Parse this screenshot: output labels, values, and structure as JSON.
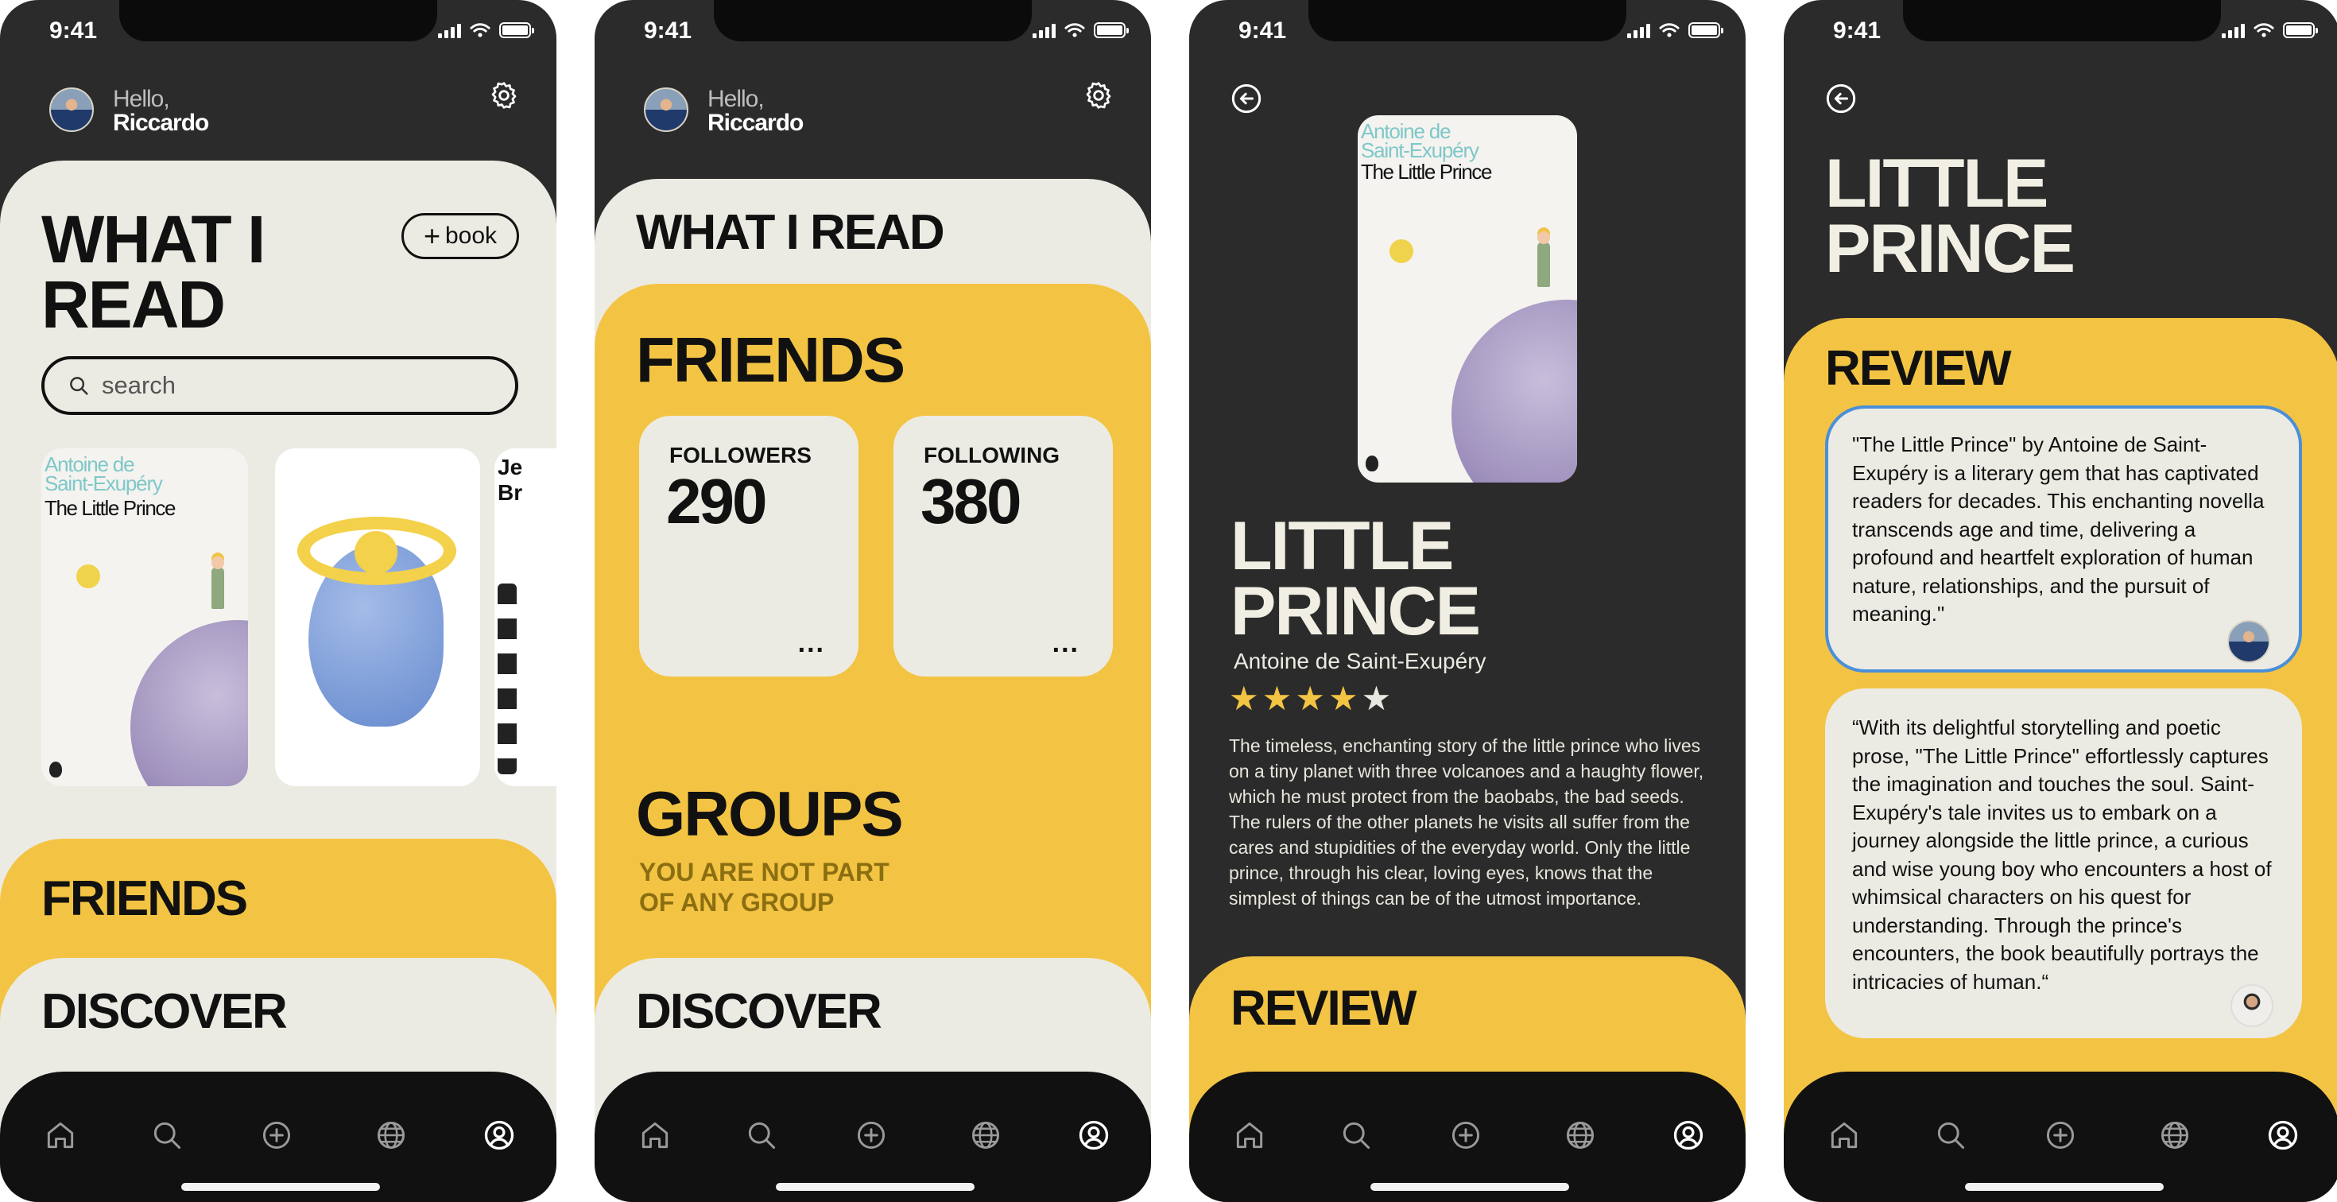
{
  "status": {
    "time": "9:41"
  },
  "greeting": {
    "hello": "Hello,",
    "name": "Riccardo"
  },
  "home": {
    "title_line1": "WHAT I",
    "title_line2": "READ",
    "add_book_label": "book",
    "search_placeholder": "search",
    "sections": {
      "friends": "FRIENDS",
      "discover": "DISCOVER"
    }
  },
  "friends_screen": {
    "what_i_read": "WHAT I READ",
    "friends_title": "FRIENDS",
    "followers_label": "FOLLOWERS",
    "followers_value": "290",
    "following_label": "FOLLOWING",
    "following_value": "380",
    "more": "...",
    "groups_title": "GROUPS",
    "groups_empty_line1": "YOU ARE NOT PART",
    "groups_empty_line2": "OF ANY GROUP",
    "discover": "DISCOVER"
  },
  "book": {
    "cover_author_line1": "Antoine de",
    "cover_author_line2": "Saint-Exupéry",
    "cover_title": "The Little Prince",
    "title_line1": "LITTLE",
    "title_line2": "PRINCE",
    "author": "Antoine de Saint-Exupéry",
    "rating": 4,
    "rating_max": 5,
    "description": "The timeless, enchanting story of the little prince who lives on a tiny planet with three volcanoes and a haughty flower, which he must protect from the baobabs, the bad seeds. The rulers of the other planets he visits all suffer from the cares and stupidities of the everyday world. Only the little prince, through his clear, loving eyes, knows that the simplest of things can be of the utmost importance.",
    "review_title": "REVIEW"
  },
  "third_cover_snippet": {
    "line1": "Je",
    "line2": "Br"
  },
  "reviews": [
    {
      "text": "\"The Little Prince\" by Antoine de Saint-Exupéry is a literary gem that has captivated readers for decades. This enchanting novella transcends age and time, delivering a profound and heartfelt exploration of human nature, relationships, and the pursuit of meaning.\""
    },
    {
      "text": "“With its delightful storytelling and poetic prose, \"The Little Prince\" effortlessly captures the imagination and touches the soul. Saint-Exupéry's tale invites us to embark on a journey alongside the little prince, a curious and wise young boy who encounters a host of whimsical characters on his quest for understanding. Through the prince's encounters, the book beautifully portrays the intricacies of human.“"
    }
  ],
  "nav": [
    {
      "icon": "home-icon"
    },
    {
      "icon": "search-icon"
    },
    {
      "icon": "add-circle-icon"
    },
    {
      "icon": "globe-icon"
    },
    {
      "icon": "profile-icon"
    }
  ],
  "colors": {
    "background": "#2b2b2b",
    "cream": "#ecebe3",
    "yellow": "#f3c443",
    "nav": "#111111",
    "review_active_border": "#4a8fd9",
    "star": "#f3c443"
  }
}
